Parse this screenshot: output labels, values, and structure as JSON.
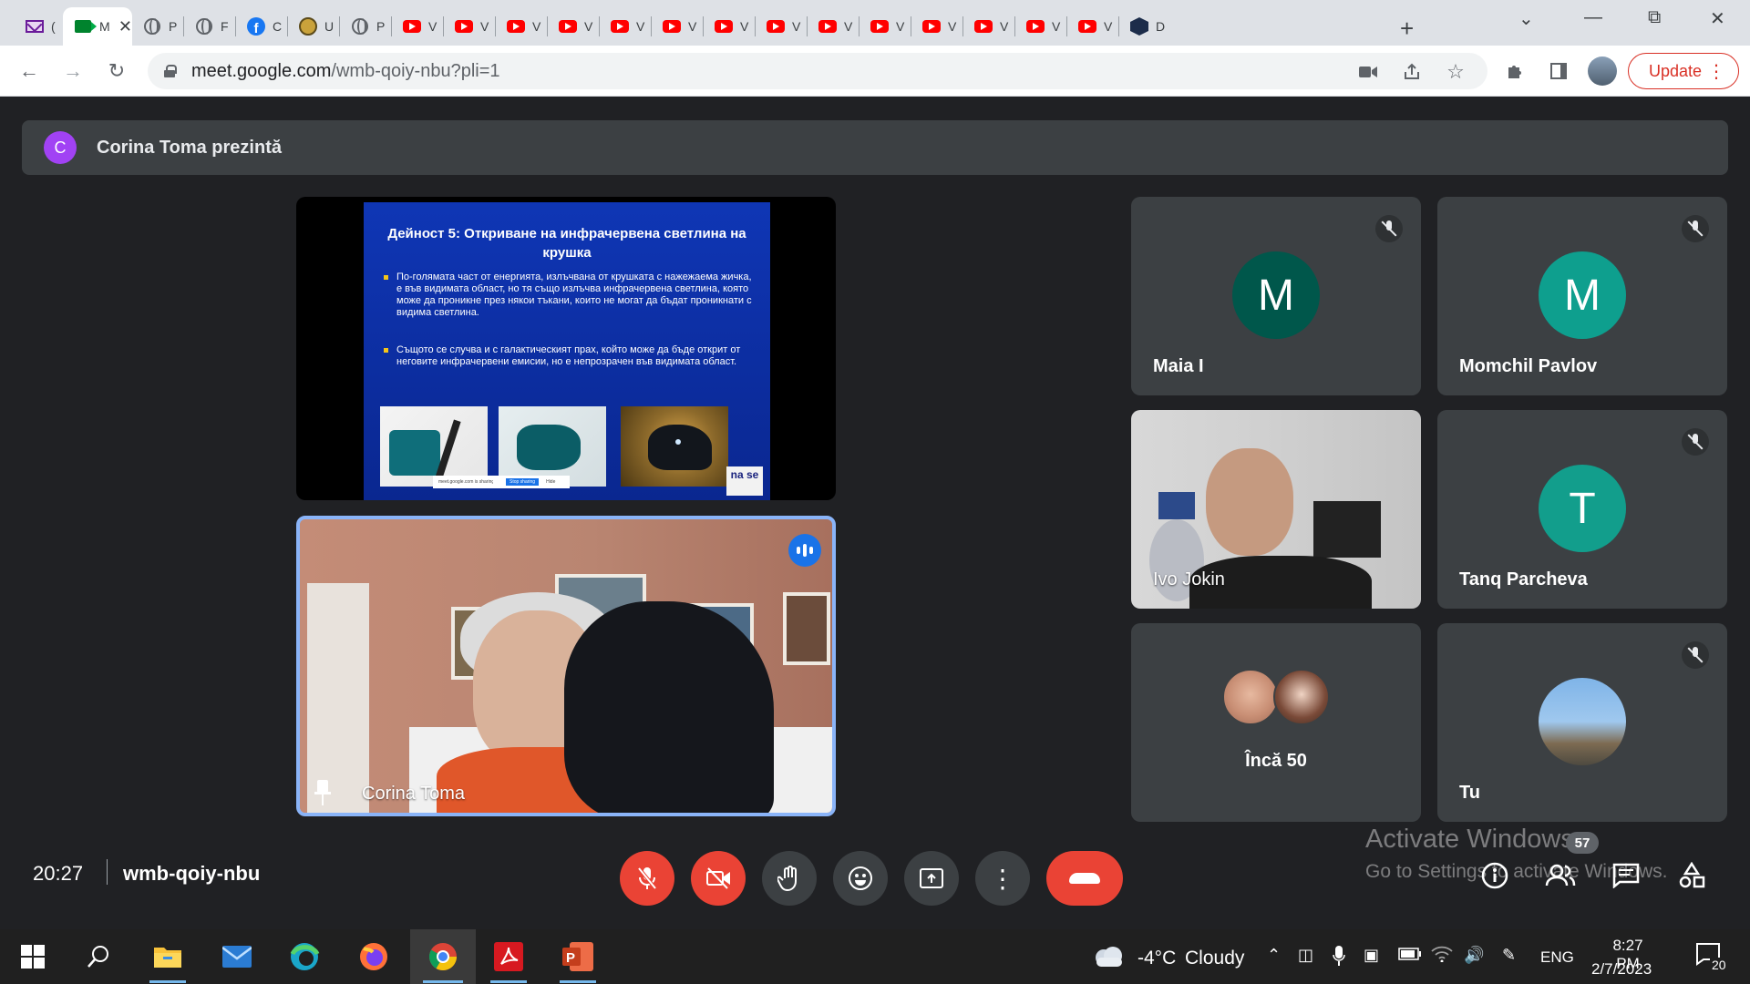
{
  "browser": {
    "tabs": [
      {
        "favicon": "gmail-icon",
        "title": "(",
        "active": false
      },
      {
        "favicon": "meet-icon",
        "title": "M",
        "active": true
      },
      {
        "favicon": "globe-icon",
        "title": "P",
        "active": false
      },
      {
        "favicon": "globe-icon",
        "title": "F",
        "active": false
      },
      {
        "favicon": "facebook-icon",
        "title": "C",
        "active": false
      },
      {
        "favicon": "university-icon",
        "title": "U",
        "active": false
      },
      {
        "favicon": "globe-icon",
        "title": "P",
        "active": false
      },
      {
        "favicon": "youtube-icon",
        "title": "V",
        "active": false
      },
      {
        "favicon": "youtube-icon",
        "title": "V",
        "active": false
      },
      {
        "favicon": "youtube-icon",
        "title": "V",
        "active": false
      },
      {
        "favicon": "youtube-icon",
        "title": "V",
        "active": false
      },
      {
        "favicon": "youtube-icon",
        "title": "V",
        "active": false
      },
      {
        "favicon": "youtube-icon",
        "title": "V",
        "active": false
      },
      {
        "favicon": "youtube-icon",
        "title": "V",
        "active": false
      },
      {
        "favicon": "youtube-icon",
        "title": "V",
        "active": false
      },
      {
        "favicon": "youtube-icon",
        "title": "V",
        "active": false
      },
      {
        "favicon": "youtube-icon",
        "title": "V",
        "active": false
      },
      {
        "favicon": "youtube-icon",
        "title": "V",
        "active": false
      },
      {
        "favicon": "youtube-icon",
        "title": "V",
        "active": false
      },
      {
        "favicon": "youtube-icon",
        "title": "V",
        "active": false
      },
      {
        "favicon": "youtube-icon",
        "title": "V",
        "active": false
      },
      {
        "favicon": "dark-hex-icon",
        "title": "D",
        "active": false
      }
    ],
    "new_tab_label": "+",
    "url_host": "meet.google.com",
    "url_path": "/wmb-qoiy-nbu?pli=1",
    "update_label": "Update"
  },
  "meet": {
    "presenter_initial": "C",
    "presenting_text": "Corina Toma prezintă",
    "slide": {
      "title": "Дейност 5: Откриване на инфрачервена светлина на крушка",
      "bullet_1": "По-голямата част от енергията, излъчвана от крушката с нажежаема жичка, е във видимата област, но тя също излъчва инфрачервена светлина, която може да проникне през някои тъкани, които не могат да бъдат проникнати с видима светлина.",
      "bullet_2": "Същото се случва и с галактическият прах, който може да бъде открит от неговите инфрачервени емисии, но е непрозрачен във видимата област.",
      "logo_text": "na se",
      "share_text": "meet.google.com is sharing your screen",
      "stop_label": "Stop sharing",
      "hide_label": "Hide"
    },
    "speaker_name": "Corina Toma",
    "participants": [
      {
        "name": "Maia I",
        "initial": "M",
        "color": "#00574b",
        "muted": true
      },
      {
        "name": "Momchil Pavlov",
        "initial": "M",
        "color": "#12b5cb",
        "muted": true
      },
      {
        "name": "Ivo Jokin",
        "initial": "",
        "color": "",
        "muted": false
      },
      {
        "name": "Tanq Parcheva",
        "initial": "T",
        "color": "#129eaf",
        "muted": true
      },
      {
        "name": "Încă 50",
        "initial": "",
        "color": "",
        "muted": false
      },
      {
        "name": "Tu",
        "initial": "",
        "color": "",
        "muted": true
      }
    ],
    "meeting_time": "20:27",
    "meeting_code": "wmb-qoiy-nbu",
    "people_count": "57",
    "watermark_line1": "Activate Windows",
    "watermark_line2": "Go to Settings to activate Windows."
  },
  "taskbar": {
    "weather_temp": "-4°C",
    "weather_desc": "Cloudy",
    "language": "ENG",
    "time": "8:27 PM",
    "date": "2/7/2023",
    "notifications": "20"
  }
}
